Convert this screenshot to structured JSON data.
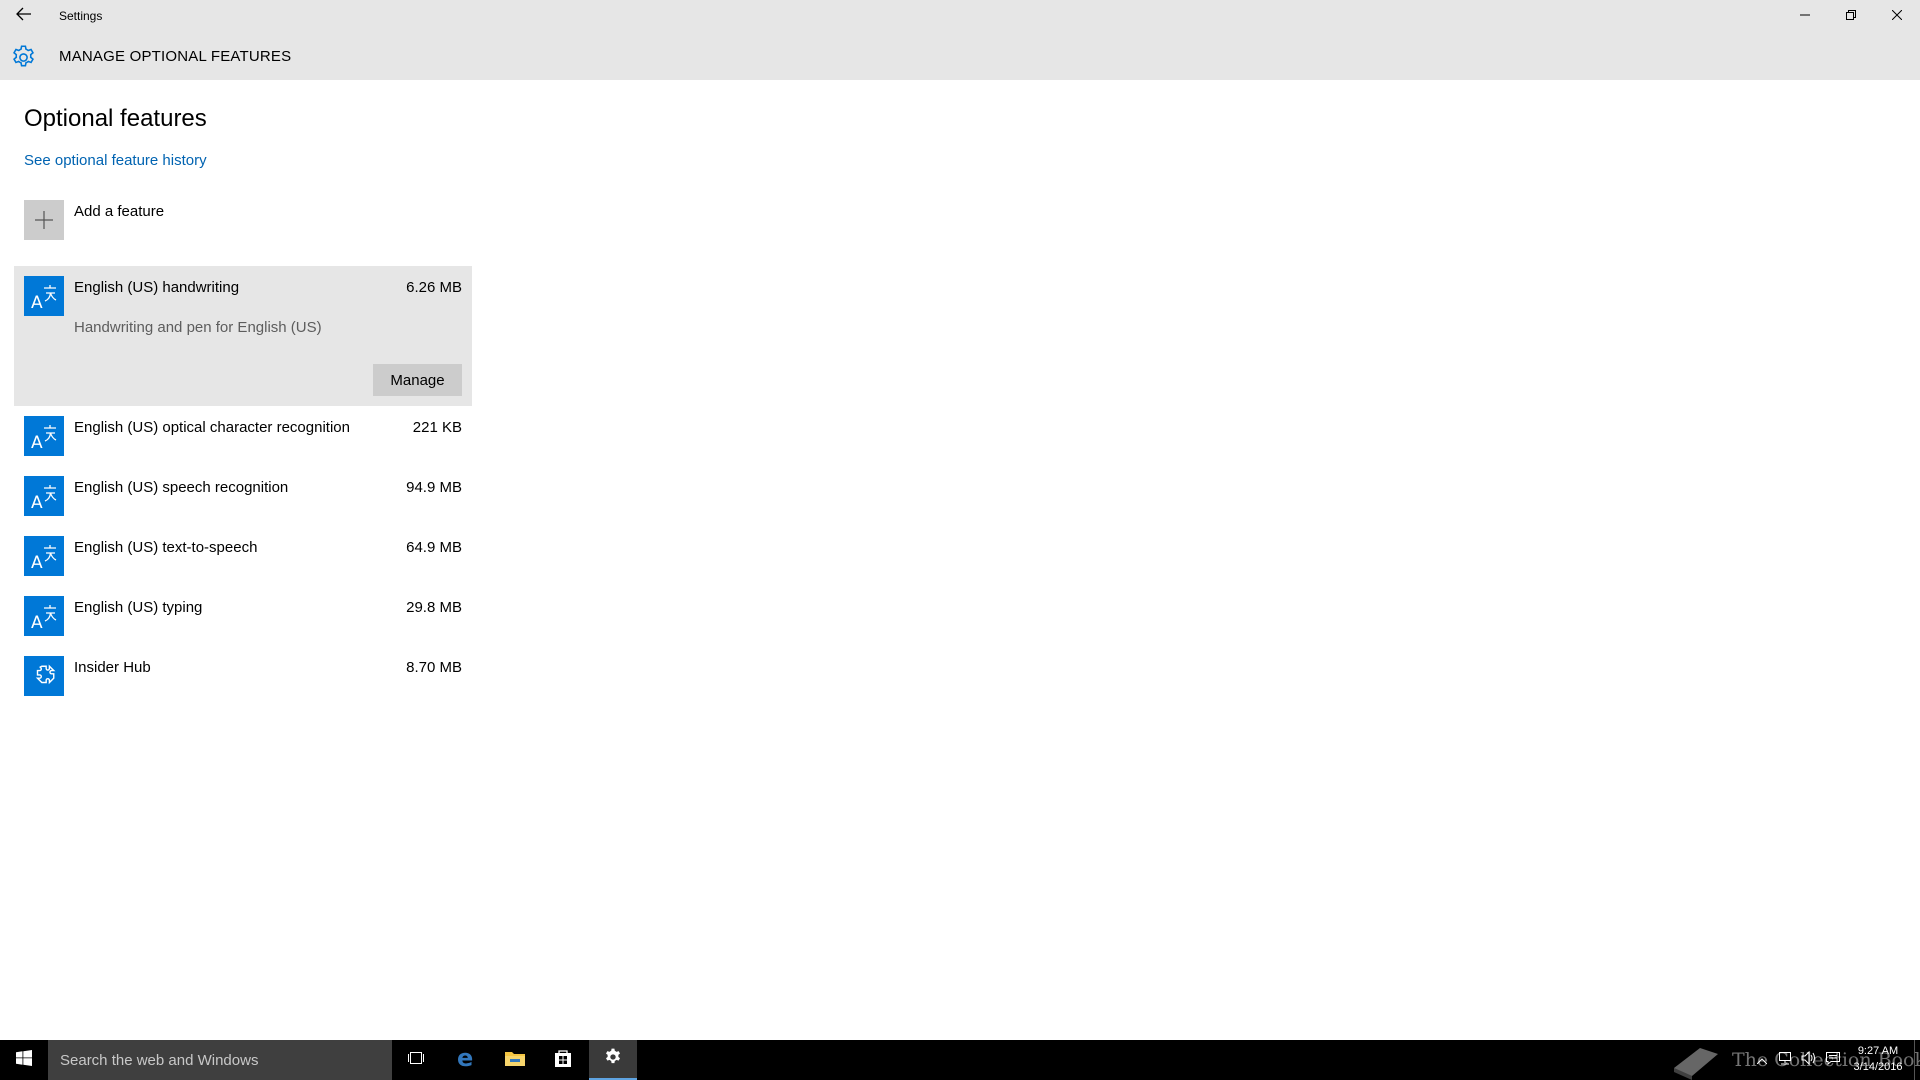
{
  "window": {
    "title": "Settings",
    "back_icon": "back-arrow-icon",
    "controls": [
      "minimize-icon",
      "restore-icon",
      "close-icon"
    ]
  },
  "header": {
    "icon": "gear-icon",
    "title": "MANAGE OPTIONAL FEATURES"
  },
  "main": {
    "section_title": "Optional features",
    "history_link": "See optional feature history",
    "add_feature": {
      "label": "Add a feature",
      "icon": "plus-icon"
    },
    "features": [
      {
        "name": "English (US) handwriting",
        "size": "6.26 MB",
        "icon": "language-icon",
        "expanded": true,
        "description": "Handwriting and pen for English (US)",
        "action_label": "Manage"
      },
      {
        "name": "English (US) optical character recognition",
        "size": "221 KB",
        "icon": "language-icon"
      },
      {
        "name": "English (US) speech recognition",
        "size": "94.9 MB",
        "icon": "language-icon"
      },
      {
        "name": "English (US) text-to-speech",
        "size": "64.9 MB",
        "icon": "language-icon"
      },
      {
        "name": "English (US) typing",
        "size": "29.8 MB",
        "icon": "language-icon"
      },
      {
        "name": "Insider Hub",
        "size": "8.70 MB",
        "icon": "puzzle-icon"
      }
    ]
  },
  "taskbar": {
    "search_placeholder": "Search the web and Windows",
    "apps": [
      "task-view-icon",
      "edge-icon",
      "file-explorer-icon",
      "store-icon",
      "settings-icon"
    ],
    "active_app": "settings-icon",
    "tray": [
      "chevron-up-icon",
      "network-icon",
      "volume-icon",
      "action-center-icon"
    ],
    "time": "9:27 AM",
    "date": "3/14/2016",
    "watermark": "The Collection Book",
    "colors": {
      "accent": "#0078d7",
      "link": "#0063b1",
      "taskbar": "#000000"
    }
  }
}
